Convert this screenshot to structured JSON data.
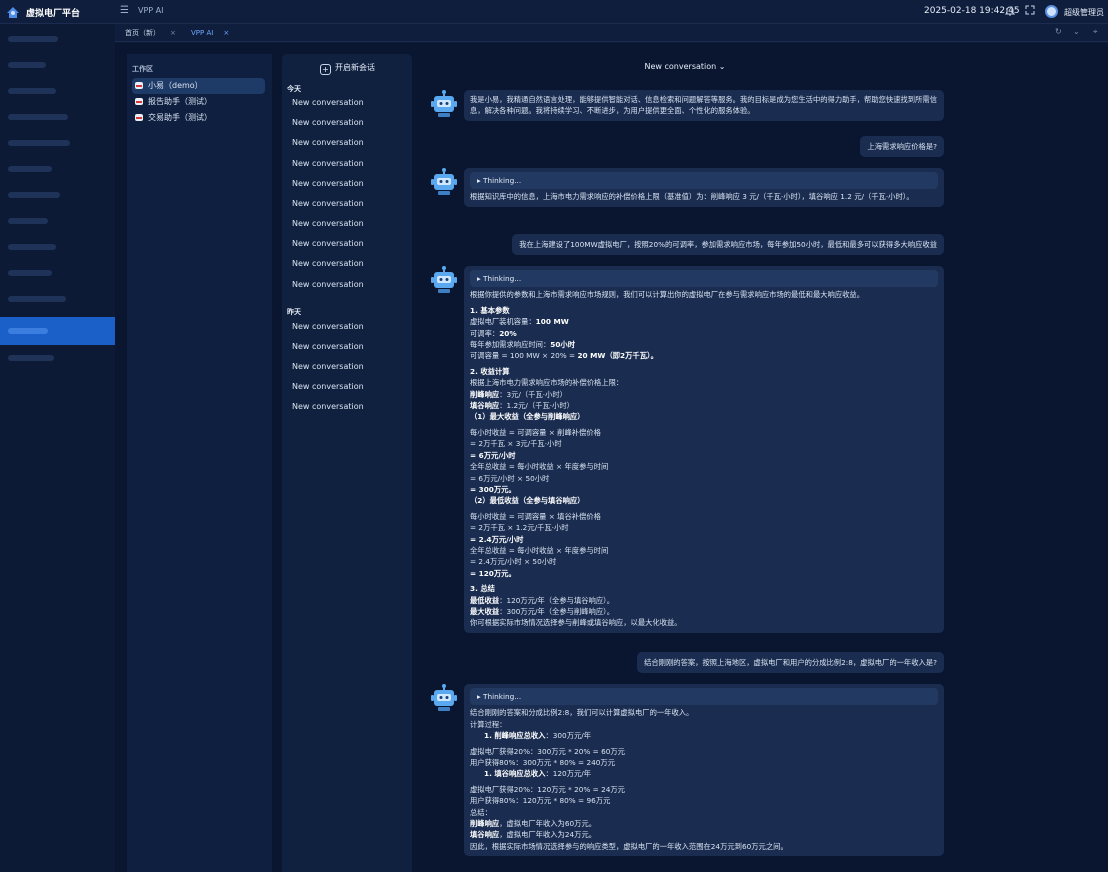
{
  "topbar": {
    "brand": "虚拟电厂平台",
    "page_label": "VPP AI",
    "datetime": "2025-02-18 19:42:45",
    "user": "超级管理员",
    "icons": [
      "bell-icon",
      "fullscreen-icon"
    ]
  },
  "tabs": [
    {
      "label": "首页（新）",
      "close": "×"
    },
    {
      "label": "VPP AI",
      "close": "×"
    }
  ],
  "workspace": {
    "title": "工作区",
    "items": [
      "小易（demo）",
      "报告助手（测试）",
      "交易助手（测试）"
    ]
  },
  "conversations": {
    "new_chat": "开启新会话",
    "today_label": "今天",
    "today": [
      "New conversation",
      "New conversation",
      "New conversation",
      "New conversation",
      "New conversation",
      "New conversation",
      "New conversation",
      "New conversation",
      "New conversation",
      "New conversation"
    ],
    "yesterday_label": "昨天",
    "yesterday": [
      "New conversation",
      "New conversation",
      "New conversation",
      "New conversation",
      "New conversation"
    ]
  },
  "chat": {
    "header": "New conversation ⌄",
    "thinking": "▸ Thinking...",
    "m1": "我是小易，我精通自然语言处理，能够提供智能对话、信息检索和问题解答等服务。我的目标是成为您生活中的得力助手，帮助您快速找到所需信息，解决各种问题。我将持续学习、不断进步，为用户提供更全面、个性化的服务体验。",
    "u1": "上海需求响应价格是?",
    "m2": "根据知识库中的信息，上海市电力需求响应的补偿价格上限（基准值）为：削峰响应 3 元/（千瓦·小时），填谷响应 1.2 元/（千瓦·小时）。",
    "u2": "我在上海建设了100MW虚拟电厂，按照20%的可调率，参加需求响应市场，每年参加50小时，最低和最多可以获得多大响应收益",
    "m3": {
      "intro": "根据你提供的参数和上海市需求响应市场规则，我们可以计算出你的虚拟电厂在参与需求响应市场的最低和最大响应收益。",
      "h1": "1. 基本参数",
      "p1_label": "虚拟电厂装机容量：",
      "p1_val": "100 MW",
      "p2_label": "可调率：",
      "p2_val": "20%",
      "p3_label": "每年参加需求响应时间：",
      "p3_val": "50小时",
      "p4_label": "可调容量 = 100 MW × 20% = ",
      "p4_val": "20 MW（即2万千瓦）。",
      "h2": "2. 收益计算",
      "l1": "根据上海市电力需求响应市场的补偿价格上限：",
      "l2_label": "削峰响应",
      "l2_val": "：3元/（千瓦·小时）",
      "l3_label": "填谷响应",
      "l3_val": "：1.2元/（千瓦·小时）",
      "s1": "（1）最大收益（全参与削峰响应）",
      "a1": "每小时收益 = 可调容量 × 削峰补偿价格",
      "a2": "= 2万千瓦 × 3元/千瓦·小时",
      "a3": "= 6万元/小时",
      "a4": "全年总收益 = 每小时收益 × 年度参与时间",
      "a5": "= 6万元/小时 × 50小时",
      "a6": "= 300万元。",
      "s2": "（2）最低收益（全参与填谷响应）",
      "b1": "每小时收益 = 可调容量 × 填谷补偿价格",
      "b2": "= 2万千瓦 × 1.2元/千瓦·小时",
      "b3": "= 2.4万元/小时",
      "b4": "全年总收益 = 每小时收益 × 年度参与时间",
      "b5": "= 2.4万元/小时 × 50小时",
      "b6": "= 120万元。",
      "h3": "3. 总结",
      "c1_label": "最低收益",
      "c1_val": "：120万元/年（全参与填谷响应）。",
      "c2_label": "最大收益",
      "c2_val": "：300万元/年（全参与削峰响应）。",
      "c3": "你可根据实际市场情况选择参与削峰或填谷响应，以最大化收益。"
    },
    "u3": "结合刚刚的答案，按照上海地区，虚拟电厂和用户的分成比例2:8，虚拟电厂的一年收入是?",
    "m4": {
      "l1": "结合刚刚的答案和分成比例2:8，我们可以计算虚拟电厂的一年收入。",
      "l2": "计算过程：",
      "l3_label": "1. 削峰响应总收入",
      "l3_val": "：300万元/年",
      "l4": "虚拟电厂获得20%：300万元 * 20% = 60万元",
      "l5": "用户获得80%：300万元 * 80% = 240万元",
      "l6_label": "1. 填谷响应总收入",
      "l6_val": "：120万元/年",
      "l7": "虚拟电厂获得20%：120万元 * 20% = 24万元",
      "l8": "用户获得80%：120万元 * 80% = 96万元",
      "l9": "总结：",
      "l10_label": "削峰响应",
      "l10_val": "，虚拟电厂年收入为60万元。",
      "l11_label": "填谷响应",
      "l11_val": "，虚拟电厂年收入为24万元。",
      "l12": "因此，根据实际市场情况选择参与的响应类型，虚拟电厂的一年收入范围在24万元到60万元之间。"
    }
  }
}
